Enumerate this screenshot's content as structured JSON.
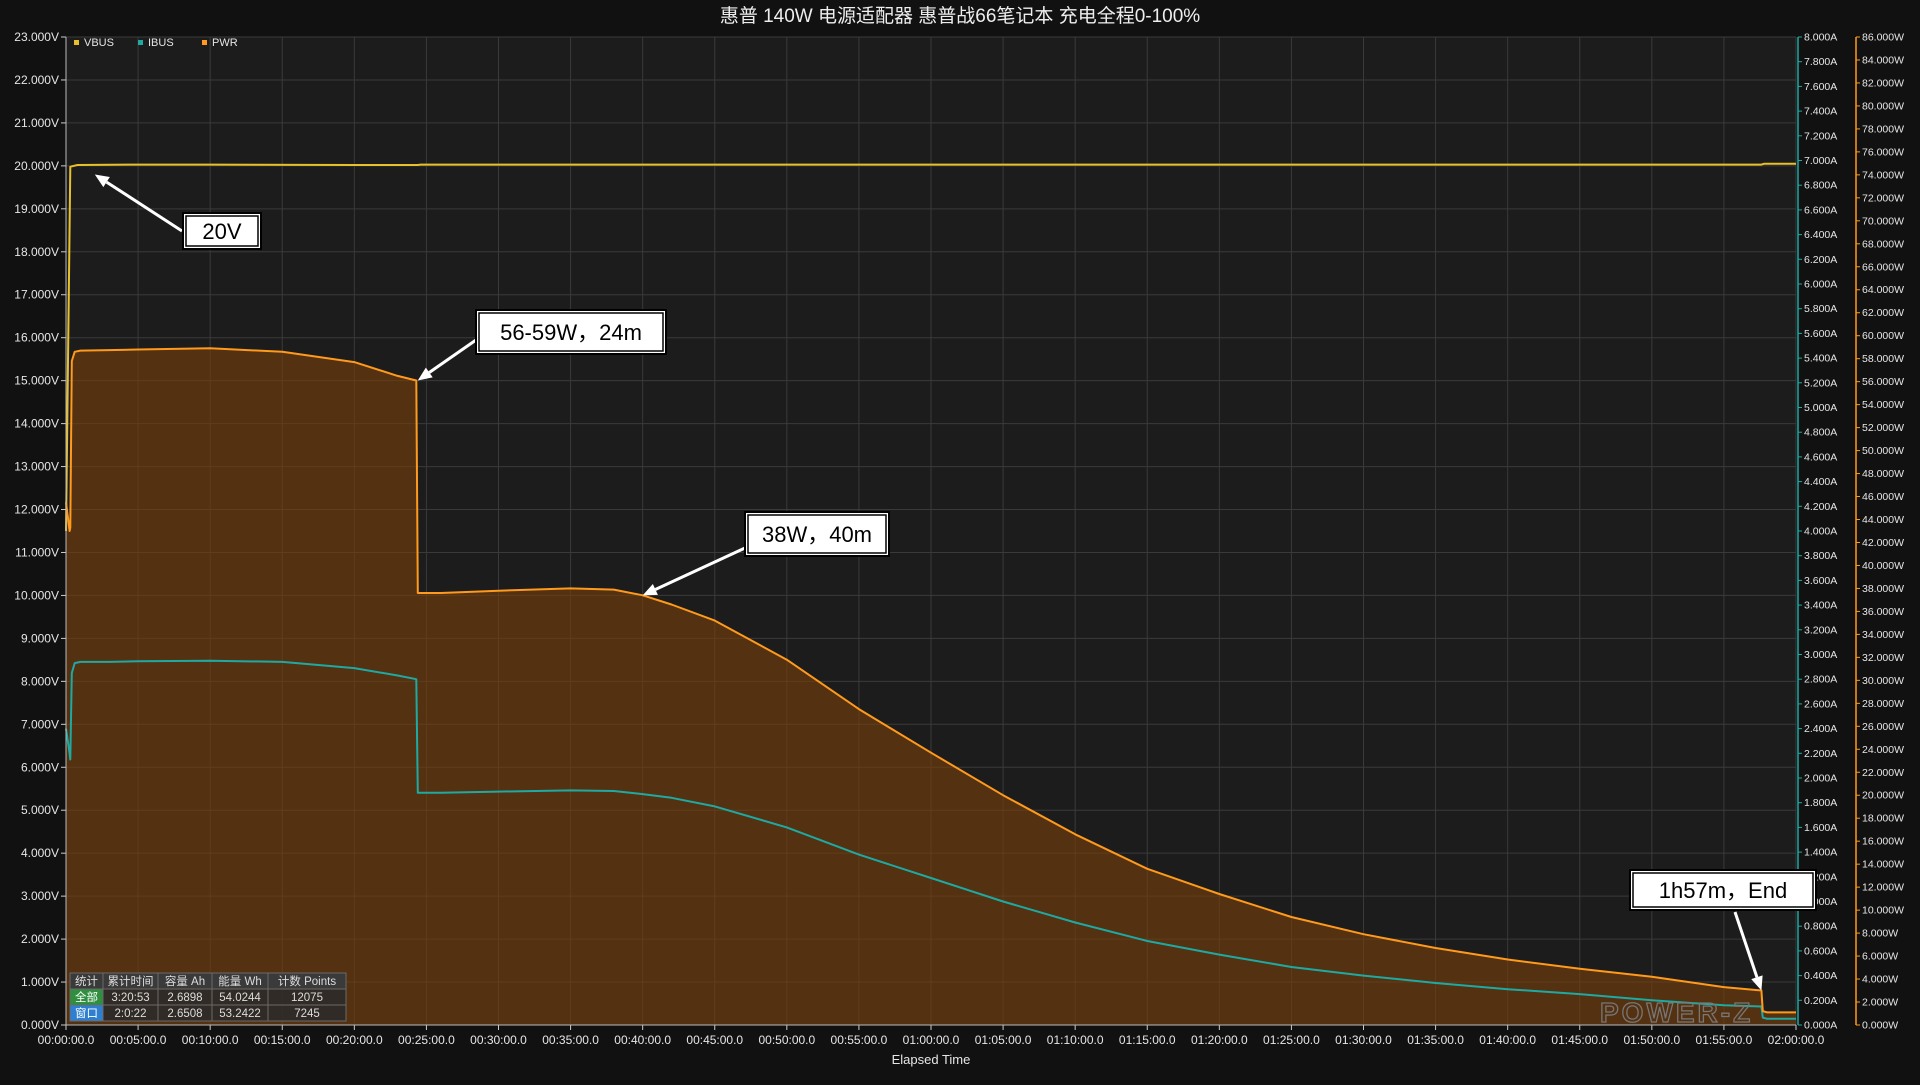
{
  "title": "惠普 140W 电源适配器  惠普战66笔记本 充电全程0-100%",
  "colors": {
    "background": "#111111",
    "plot_bg": "#1c1c1c",
    "grid": "#3a3a3a",
    "axis_text": "#e6e6e6",
    "vbus": "#e8c12a",
    "ibus": "#1fa9a3",
    "pwr": "#ff9a1c",
    "pwr_fill": "#7a3f08",
    "callout_bg": "#ffffff",
    "callout_text": "#000000",
    "stats_all_label_bg": "#2f8f3f",
    "stats_window_label_bg": "#2f7fd0"
  },
  "chart_data": {
    "type": "line",
    "title": "惠普 140W 电源适配器  惠普战66笔记本 充电全程0-100%",
    "xlabel": "Elapsed Time",
    "x_unit": "minutes",
    "xlim": [
      0,
      120
    ],
    "x_ticks": [
      "00:00:00.0",
      "00:05:00.0",
      "00:10:00.0",
      "00:15:00.0",
      "00:20:00.0",
      "00:25:00.0",
      "00:30:00.0",
      "00:35:00.0",
      "00:40:00.0",
      "00:45:00.0",
      "00:50:00.0",
      "00:55:00.0",
      "01:00:00.0",
      "01:05:00.0",
      "01:10:00.0",
      "01:15:00.0",
      "01:20:00.0",
      "01:25:00.0",
      "01:30:00.0",
      "01:35:00.0",
      "01:40:00.0",
      "01:45:00.0",
      "01:50:00.0",
      "01:55:00.0",
      "02:00:00.0"
    ],
    "axes": {
      "voltage": {
        "side": "left",
        "unit": "V",
        "ylim": [
          0,
          23
        ],
        "step": 1
      },
      "current": {
        "side": "right-inner",
        "unit": "A",
        "ylim": [
          0,
          8
        ],
        "step": 0.2
      },
      "power": {
        "side": "right-outer",
        "unit": "W",
        "ylim": [
          0,
          86
        ],
        "step": 2
      }
    },
    "legend": {
      "placement": "top-left",
      "entries": [
        "VBUS",
        "IBUS",
        "PWR"
      ]
    },
    "grid": true,
    "series": [
      {
        "name": "VBUS",
        "axis": "voltage",
        "x": [
          0,
          0.3,
          0.8,
          5,
          10,
          20,
          24.4,
          24.6,
          30,
          40,
          60,
          80,
          100,
          117.6,
          117.8,
          120
        ],
        "y": [
          11.5,
          19.98,
          20.02,
          20.03,
          20.03,
          20.02,
          20.02,
          20.03,
          20.03,
          20.03,
          20.03,
          20.03,
          20.03,
          20.03,
          20.05,
          20.05
        ]
      },
      {
        "name": "IBUS",
        "axis": "current",
        "x": [
          0,
          0.25,
          0.3,
          0.4,
          0.6,
          1,
          3,
          5,
          10,
          15,
          20,
          23,
          24.3,
          24.4,
          26,
          30,
          35,
          38,
          40,
          42,
          45,
          50,
          55,
          60,
          65,
          70,
          75,
          80,
          85,
          90,
          95,
          100,
          105,
          110,
          115,
          117.6,
          117.7,
          118,
          120
        ],
        "y": [
          2.4,
          2.2,
          2.15,
          2.85,
          2.93,
          2.94,
          2.94,
          2.945,
          2.95,
          2.94,
          2.89,
          2.83,
          2.8,
          1.88,
          1.88,
          1.89,
          1.9,
          1.895,
          1.87,
          1.84,
          1.77,
          1.6,
          1.38,
          1.19,
          1.0,
          0.83,
          0.68,
          0.57,
          0.47,
          0.4,
          0.34,
          0.29,
          0.25,
          0.2,
          0.16,
          0.15,
          0.06,
          0.05,
          0.05
        ]
      },
      {
        "name": "PWR",
        "axis": "power",
        "x": [
          0,
          0.25,
          0.3,
          0.4,
          0.6,
          1,
          3,
          5,
          10,
          15,
          20,
          23,
          24.3,
          24.4,
          26,
          30,
          35,
          38,
          40,
          42,
          45,
          50,
          55,
          60,
          65,
          70,
          75,
          80,
          85,
          90,
          95,
          100,
          105,
          110,
          115,
          117.6,
          117.7,
          118,
          120
        ],
        "y": [
          45.5,
          43.0,
          43.3,
          57.8,
          58.6,
          58.7,
          58.75,
          58.8,
          58.9,
          58.6,
          57.7,
          56.5,
          56.1,
          37.6,
          37.6,
          37.8,
          38.0,
          37.9,
          37.4,
          36.6,
          35.2,
          31.8,
          27.5,
          23.7,
          20.0,
          16.6,
          13.6,
          11.4,
          9.4,
          7.9,
          6.7,
          5.7,
          4.9,
          4.2,
          3.3,
          3.0,
          1.2,
          1.1,
          1.1
        ]
      }
    ],
    "annotations": [
      {
        "text": "20V",
        "x": 2,
        "axis": "voltage",
        "y": 19.8
      },
      {
        "text": "56-59W，24m",
        "x": 24.4,
        "axis": "power",
        "y": 56.1
      },
      {
        "text": "38W，40m",
        "x": 40,
        "axis": "power",
        "y": 37.4
      },
      {
        "text": "1h57m，End",
        "x": 117.6,
        "axis": "power",
        "y": 3.0
      }
    ]
  },
  "stats_table": {
    "headers": [
      "统计",
      "累计时间",
      "容量 Ah",
      "能量 Wh",
      "计数 Points"
    ],
    "rows": [
      {
        "label": "全部",
        "cells": [
          "3:20:53",
          "2.6898",
          "54.0244",
          "12075"
        ]
      },
      {
        "label": "窗口",
        "cells": [
          "2:0:22",
          "2.6508",
          "53.2422",
          "7245"
        ]
      }
    ]
  },
  "watermark": "POWER-Z"
}
